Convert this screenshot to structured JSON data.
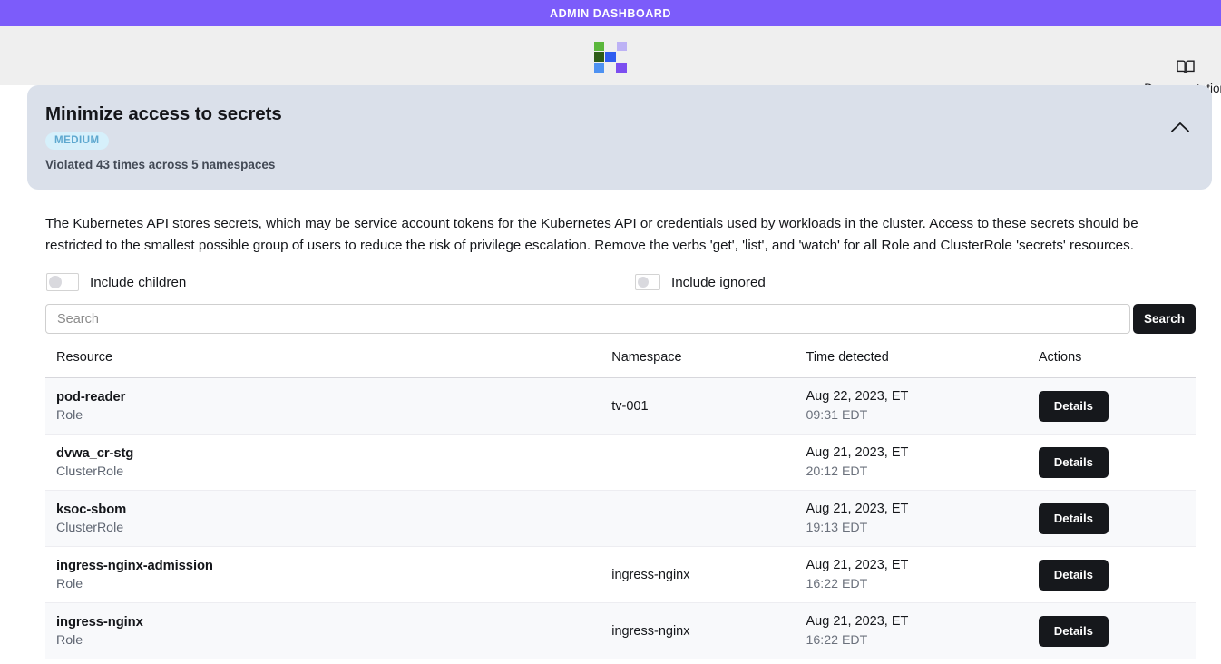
{
  "admin_bar": {
    "label": "ADMIN DASHBOARD",
    "color": "#7c5cfa"
  },
  "header": {
    "logo_name": "app-logo",
    "action": {
      "label": "Documentation",
      "icon": "book-icon"
    }
  },
  "banner": {
    "title": "Minimize access to secrets",
    "severity": "MEDIUM",
    "severity_bg": "#d6f0fb",
    "severity_color": "#5ea8cf",
    "subtitle": "Violated 43 times across 5 namespaces",
    "collapse_icon": "chevron-up-icon",
    "background": "#dae0ea"
  },
  "description": "The Kubernetes API stores secrets, which may be service account tokens for the Kubernetes API or credentials used by workloads in the cluster. Access to these secrets should be restricted to the smallest possible group of users to reduce the risk of privilege escalation. Remove the verbs 'get', 'list', and 'watch' for all Role and ClusterRole 'secrets' resources.",
  "toggles": [
    {
      "label": "Include children",
      "on": false
    },
    {
      "label": "Include ignored",
      "on": false
    }
  ],
  "search": {
    "placeholder": "Search",
    "value": "",
    "button_label": "Search"
  },
  "table": {
    "columns": [
      "Resource",
      "Namespace",
      "Time detected",
      "Actions"
    ],
    "action_label": "Details",
    "rows": [
      {
        "resource": "pod-reader",
        "kind": "Role",
        "namespace": "tv-001",
        "date": "Aug 22, 2023, ET",
        "time": "09:31 EDT"
      },
      {
        "resource": "dvwa_cr-stg",
        "kind": "ClusterRole",
        "namespace": "",
        "date": "Aug 21, 2023, ET",
        "time": "20:12 EDT"
      },
      {
        "resource": "ksoc-sbom",
        "kind": "ClusterRole",
        "namespace": "",
        "date": "Aug 21, 2023, ET",
        "time": "19:13 EDT"
      },
      {
        "resource": "ingress-nginx-admission",
        "kind": "Role",
        "namespace": "ingress-nginx",
        "date": "Aug 21, 2023, ET",
        "time": "16:22 EDT"
      },
      {
        "resource": "ingress-nginx",
        "kind": "Role",
        "namespace": "ingress-nginx",
        "date": "Aug 21, 2023, ET",
        "time": "16:22 EDT"
      }
    ]
  }
}
